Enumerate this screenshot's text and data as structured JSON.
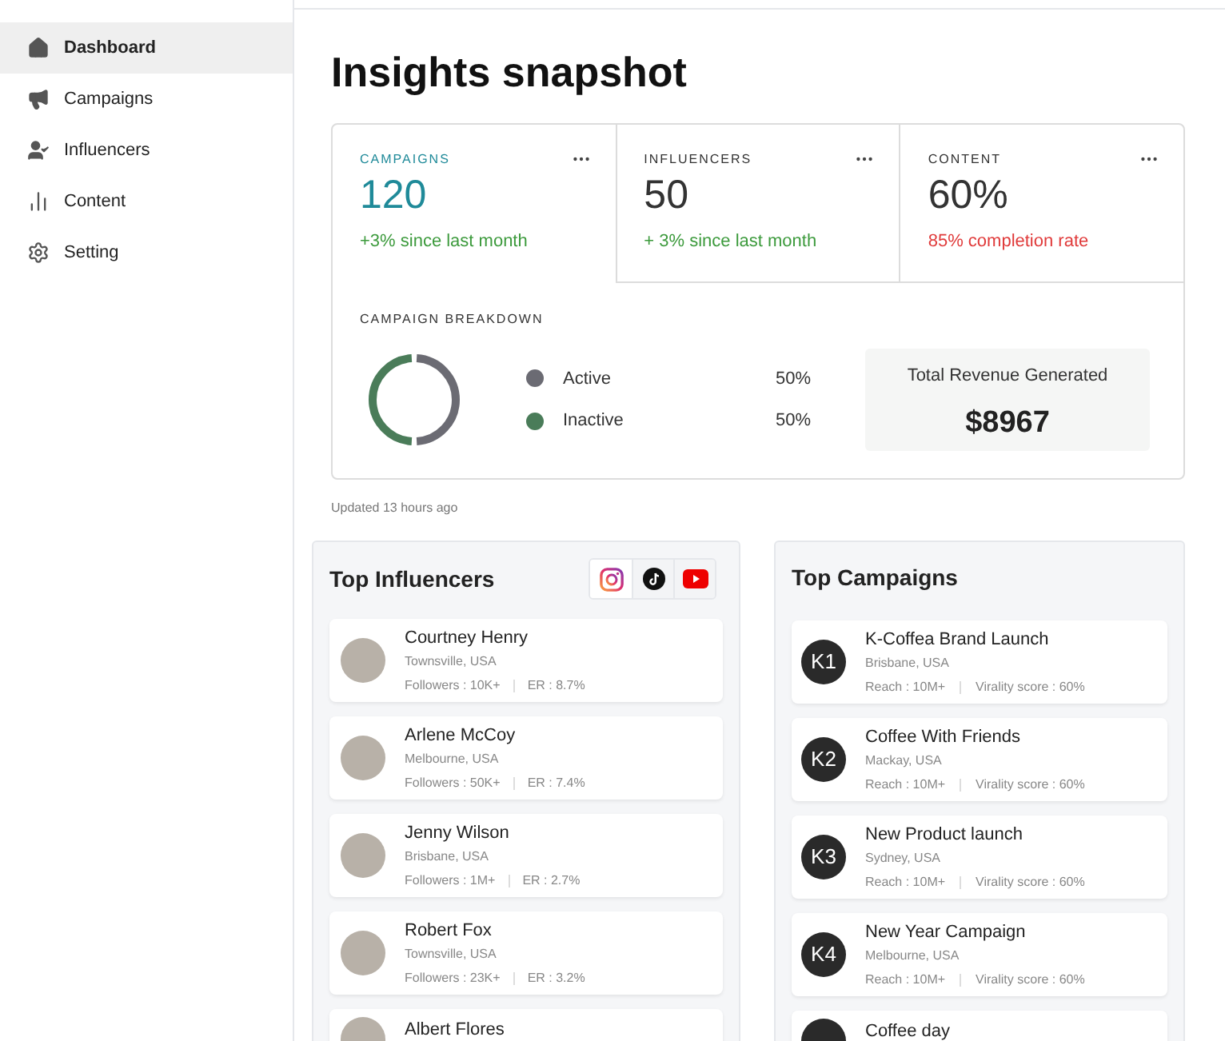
{
  "sidebar": {
    "items": [
      {
        "label": "Dashboard",
        "selected": true
      },
      {
        "label": "Campaigns",
        "selected": false
      },
      {
        "label": "Influencers",
        "selected": false
      },
      {
        "label": "Content",
        "selected": false
      },
      {
        "label": "Setting",
        "selected": false
      }
    ]
  },
  "title": "Insights snapshot",
  "stats": {
    "tabs": [
      {
        "label": "CAMPAIGNS",
        "value": "120",
        "note": "+3% since last month",
        "color": "#3c9a3c",
        "selected": true
      },
      {
        "label": "INFLUENCERS",
        "value": "50",
        "note": "+ 3% since last month",
        "color": "#3c9a3c",
        "selected": false
      },
      {
        "label": "CONTENT",
        "value": "60%",
        "note": "85% completion rate",
        "color": "#e03a3a",
        "selected": false
      }
    ],
    "breakdown": {
      "title": "CAMPAIGN BREAKDOWN",
      "legend": [
        {
          "label": "Active",
          "value": "50%",
          "color": "#6b6b73"
        },
        {
          "label": "Inactive",
          "value": "50%",
          "color": "#4a7c59"
        }
      ]
    },
    "revenue": {
      "label": "Total Revenue Generated",
      "value": "$8967"
    }
  },
  "updated": "Updated 13 hours ago",
  "top_influencers": {
    "title": "Top Influencers",
    "platforms": [
      {
        "kind": "instagram",
        "selected": true
      },
      {
        "kind": "tiktok",
        "selected": false
      },
      {
        "kind": "youtube",
        "selected": false
      }
    ],
    "items": [
      {
        "name": "Courtney Henry",
        "location": "Townsville, USA",
        "followers": "Followers : 10K+",
        "er": "ER : 8.7%"
      },
      {
        "name": "Arlene McCoy",
        "location": "Melbourne, USA",
        "followers": "Followers : 50K+",
        "er": "ER : 7.4%"
      },
      {
        "name": "Jenny Wilson",
        "location": "Brisbane, USA",
        "followers": "Followers : 1M+",
        "er": "ER : 2.7%"
      },
      {
        "name": "Robert Fox",
        "location": "Townsville, USA",
        "followers": "Followers : 23K+",
        "er": "ER : 3.2%"
      },
      {
        "name": "Albert Flores"
      }
    ]
  },
  "top_campaigns": {
    "title": "Top Campaigns",
    "items": [
      {
        "badge": "K1",
        "name": "K-Coffea Brand Launch",
        "location": "Brisbane, USA",
        "reach": "Reach : 10M+",
        "virality": "Virality score : 60%"
      },
      {
        "badge": "K2",
        "name": "Coffee With Friends",
        "location": "Mackay, USA",
        "reach": "Reach : 10M+",
        "virality": "Virality score : 60%"
      },
      {
        "badge": "K3",
        "name": "New Product launch",
        "location": "Sydney, USA",
        "reach": "Reach : 10M+",
        "virality": "Virality score : 60%"
      },
      {
        "badge": "K4",
        "name": "New Year Campaign",
        "location": "Melbourne, USA",
        "reach": "Reach : 10M+",
        "virality": "Virality score : 60%"
      },
      {
        "name": "Coffee day"
      }
    ]
  }
}
